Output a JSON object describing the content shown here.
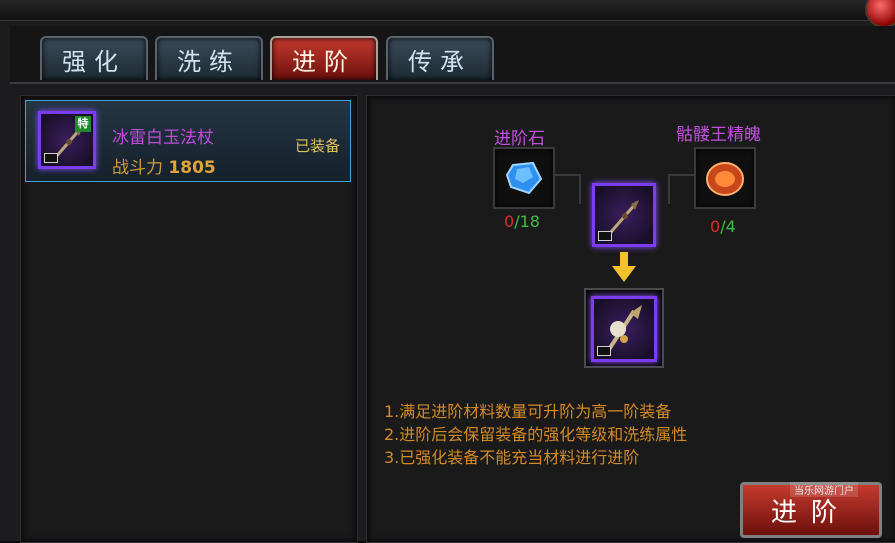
{
  "tabs": [
    {
      "label": "强化",
      "active": false
    },
    {
      "label": "洗练",
      "active": false
    },
    {
      "label": "进阶",
      "active": true
    },
    {
      "label": "传承",
      "active": false
    }
  ],
  "item": {
    "name": "冰雷白玉法杖",
    "power_label": "战斗力",
    "power_value": "1805",
    "status": "已装备",
    "badge": "特"
  },
  "materials": [
    {
      "name": "进阶石",
      "owned": "0",
      "required": "/18",
      "icon": "blue-gem-icon"
    },
    {
      "name": "骷髅王精魄",
      "owned": "0",
      "required": "/4",
      "icon": "orange-soul-icon"
    }
  ],
  "rules": [
    "1.满足进阶材料数量可升阶为高一阶装备",
    "2.进阶后会保留装备的强化等级和洗练属性",
    "3.已强化装备不能充当材料进行进阶"
  ],
  "action_button": "进阶",
  "watermark": "当乐网游门户",
  "colors": {
    "accent": "#c14bd8",
    "gold": "#d38a24",
    "active_tab": "#c43a2e",
    "green": "#3cbf3c",
    "red": "#e02a2a"
  }
}
